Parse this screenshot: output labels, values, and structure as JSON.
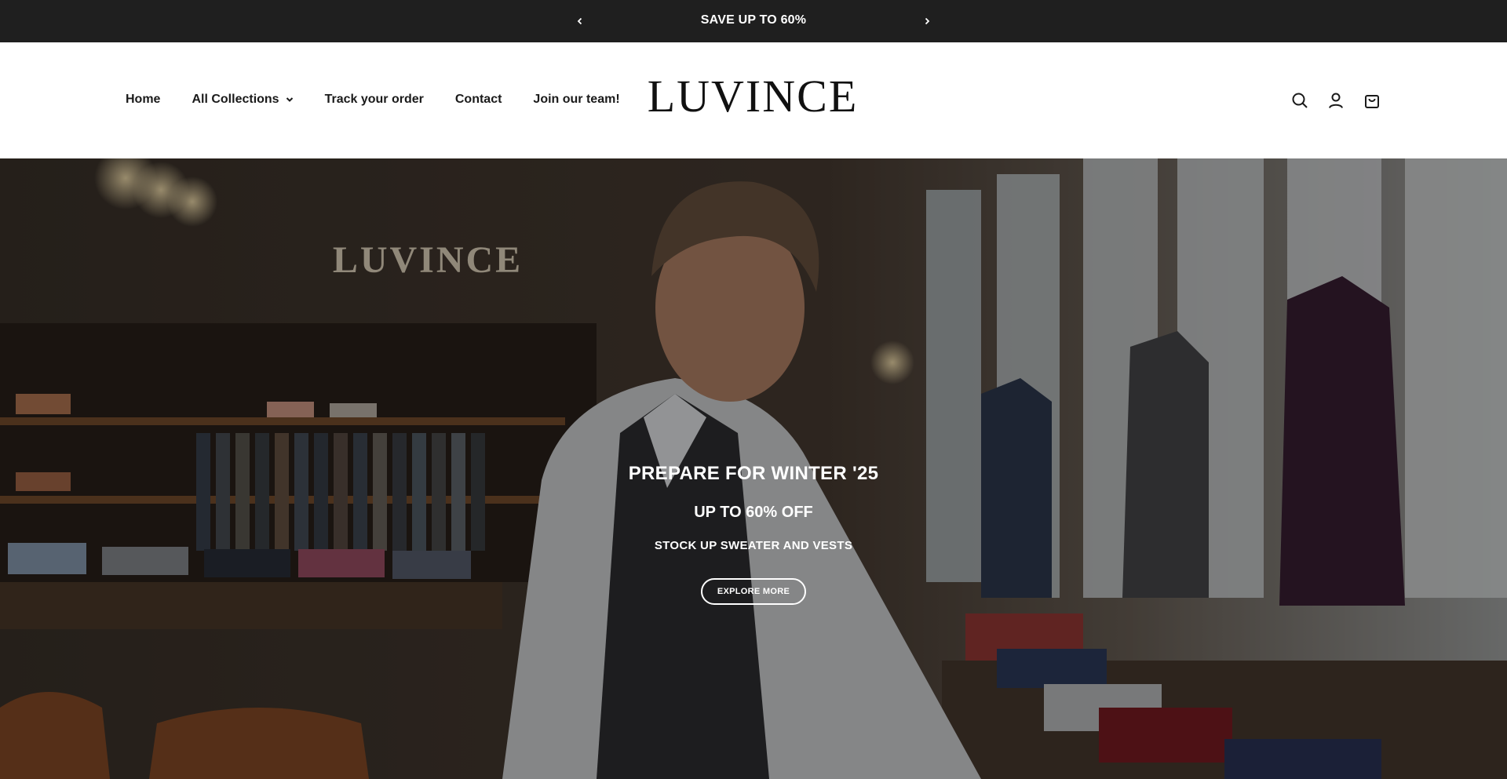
{
  "announcement": {
    "text": "SAVE UP TO 60%",
    "prev_icon": "chevron-left-icon",
    "next_icon": "chevron-right-icon"
  },
  "nav": {
    "items": [
      {
        "label": "Home"
      },
      {
        "label": "All Collections",
        "has_dropdown": true
      },
      {
        "label": "Track your order"
      },
      {
        "label": "Contact"
      },
      {
        "label": "Join our team!"
      }
    ]
  },
  "brand": {
    "logo_text": "LUVINCE"
  },
  "header_icons": [
    "search-icon",
    "account-icon",
    "cart-icon"
  ],
  "hero": {
    "heading": "PREPARE FOR WINTER '25",
    "subheading": "UP TO 60% OFF",
    "tagline": "STOCK UP SWEATER AND VESTS",
    "cta_label": "EXPLORE MORE",
    "store_sign": "LUVINCE"
  },
  "colors": {
    "announcement_bg": "#1f1f1f",
    "text_dark": "#1a1a1a",
    "hero_overlay": "rgba(0,0,0,0.38)"
  }
}
